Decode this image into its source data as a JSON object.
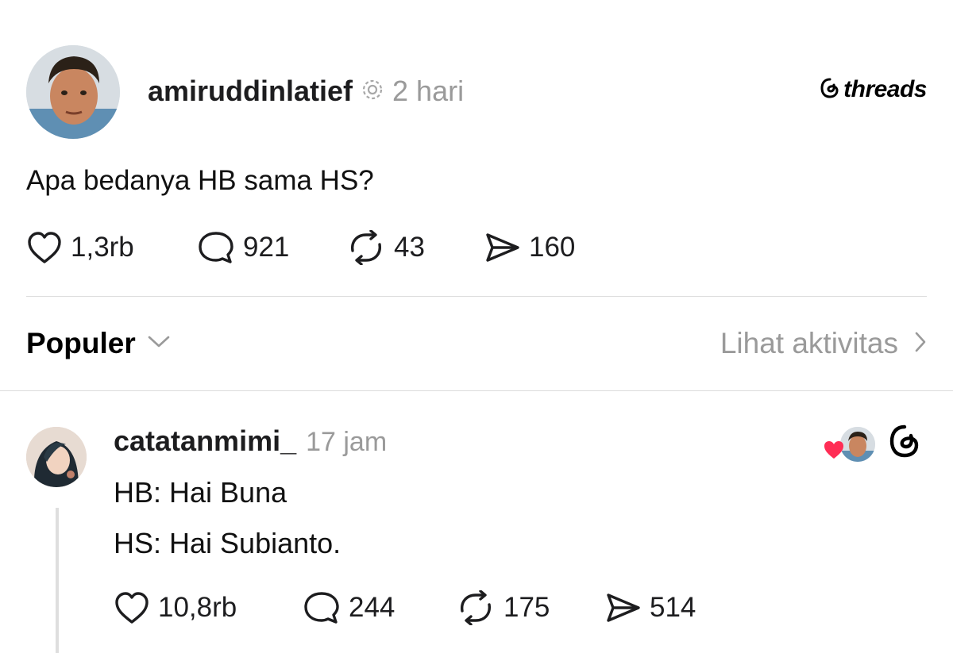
{
  "post": {
    "username": "amiruddinlatief",
    "time": "2 hari",
    "brand": "threads",
    "text": "Apa bedanya HB sama HS?",
    "stats": {
      "likes": "1,3rb",
      "replies": "921",
      "reposts": "43",
      "shares": "160"
    }
  },
  "filter": {
    "sort_label": "Populer",
    "activity_label": "Lihat aktivitas"
  },
  "reply": {
    "username": "catatanmimi_",
    "time": "17 jam",
    "lines": [
      "HB: Hai Buna",
      "HS: Hai Subianto."
    ],
    "stats": {
      "likes": "10,8rb",
      "replies": "244",
      "reposts": "175",
      "shares": "514"
    }
  },
  "colors": {
    "heart": "#ff2d55",
    "muted": "#9a9a9a",
    "text": "#1d1d1f"
  }
}
